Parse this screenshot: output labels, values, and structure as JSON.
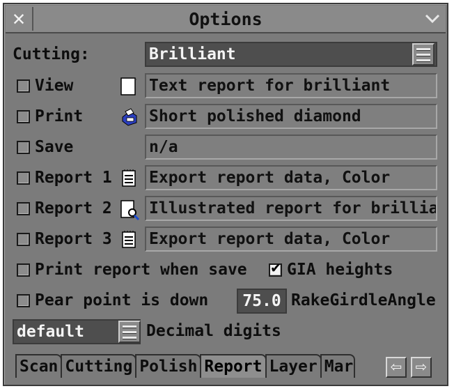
{
  "window": {
    "title": "Options",
    "close_icon": "close-icon",
    "collapse_icon": "chevron-down-icon"
  },
  "cutting": {
    "label": "Cutting:",
    "value": "Brilliant"
  },
  "rows": [
    {
      "label": "View",
      "checked": false,
      "icon": "blank-page-icon",
      "value": "Text report for brilliant"
    },
    {
      "label": "Print",
      "checked": false,
      "icon": "printer-icon",
      "value": "Short polished diamond"
    },
    {
      "label": "Save",
      "checked": false,
      "icon": "",
      "value": "n/a"
    },
    {
      "label": "Report 1",
      "checked": false,
      "icon": "notepad-icon",
      "value": "Export report data, Color"
    },
    {
      "label": "Report 2",
      "checked": false,
      "icon": "preview-icon",
      "value": "Illustrated report for brilliant,"
    },
    {
      "label": "Report 3",
      "checked": false,
      "icon": "notepad-icon",
      "value": "Export report data, Color"
    }
  ],
  "options": {
    "print_report_when_save": {
      "label": "Print report when save",
      "checked": false
    },
    "gia_heights": {
      "label": "GIA heights",
      "checked": true
    },
    "pear_point_down": {
      "label": "Pear point is down",
      "checked": false
    },
    "rake_girdle_angle": {
      "value": "75.0",
      "label": "RakeGirdleAngle"
    },
    "decimal_digits": {
      "value": "default",
      "label": "Decimal digits"
    }
  },
  "tabs": [
    {
      "label": "Scan",
      "active": false
    },
    {
      "label": "Cutting",
      "active": false
    },
    {
      "label": "Polish",
      "active": false
    },
    {
      "label": "Report",
      "active": true
    },
    {
      "label": "Layer",
      "active": false
    },
    {
      "label": "Mar",
      "active": false
    }
  ],
  "nav": {
    "prev_icon": "arrow-left-icon",
    "next_icon": "arrow-right-icon",
    "prev_glyph": "⇦",
    "next_glyph": "⇨"
  },
  "colors": {
    "window_bg": "#7b7b7b",
    "field_dark": "#4e4e4e",
    "checkbox_checked": "#f2f2f2"
  }
}
